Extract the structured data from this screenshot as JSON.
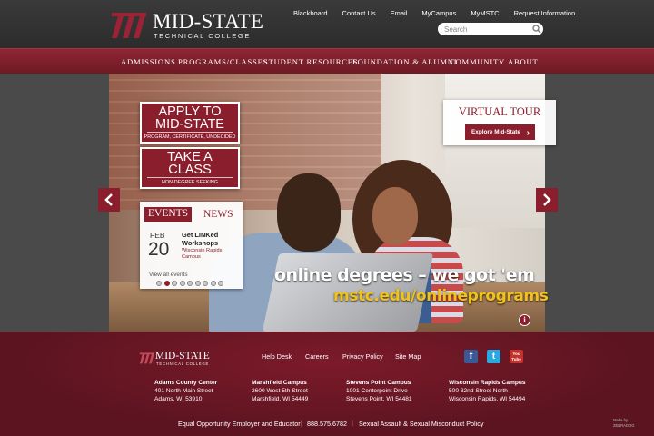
{
  "header": {
    "logo_name": "MID-STATE",
    "logo_sub": "TECHNICAL COLLEGE",
    "top_links": [
      "Blackboard",
      "Contact Us",
      "Email",
      "MyCampus",
      "MyMSTC",
      "Request Information"
    ],
    "search": {
      "placeholder": "Search",
      "icon": "magnifier-icon"
    }
  },
  "nav": {
    "items": [
      "ADMISSIONS",
      "PROGRAMS/CLASSES",
      "STUDENT RESOURCES",
      "FOUNDATION & ALUMNI",
      "COMMUNITY",
      "ABOUT"
    ]
  },
  "hero": {
    "apply": {
      "title_line1": "APPLY TO",
      "title_line2": "MID-STATE",
      "sub": "PROGRAM, CERTIFICATE, UNDECIDED"
    },
    "take_class": {
      "title_line1": "TAKE A",
      "title_line2": "CLASS",
      "sub": "NON-DEGREE SEEKING"
    },
    "events": {
      "tab_events": "EVENTS",
      "tab_news": "NEWS",
      "month": "FEB",
      "day": "20",
      "name": "Get LINKed Workshops",
      "location": "Wisconsin Rapids Campus",
      "view_all": "View all events"
    },
    "virtual_tour": {
      "title": "VIRTUAL TOUR",
      "button": "Explore Mid-State",
      "chevron": "›"
    },
    "tagline": "online degrees – we got 'em",
    "url": "mstc.edu/onlineprograms",
    "info": "i",
    "slide_count": 9,
    "active_slide": 2
  },
  "footer": {
    "logo_name": "MID-STATE",
    "logo_sub": "TECHNICAL COLLEGE",
    "links": [
      "Help Desk",
      "Careers",
      "Privacy Policy",
      "Site Map"
    ],
    "social": [
      {
        "icon": "facebook-icon",
        "glyph": "f",
        "color": "#3b5998"
      },
      {
        "icon": "twitter-icon",
        "glyph": "t",
        "color": "#2aa9e0"
      },
      {
        "icon": "youtube-icon",
        "glyph": "You Tube",
        "color": "#c4302b"
      }
    ],
    "campuses": [
      {
        "name": "Adams County Center",
        "street": "401 North Main Street",
        "city": "Adams, WI 53910"
      },
      {
        "name": "Marshfield Campus",
        "street": "2600 West 5th Street",
        "city": "Marshfield, WI 54449"
      },
      {
        "name": "Stevens Point Campus",
        "street": "1001 Centerpoint Drive",
        "city": "Stevens Point, WI 54481"
      },
      {
        "name": "Wisconsin Rapids Campus",
        "street": "500 32nd Street North",
        "city": "Wisconsin Rapids, WI 54494"
      }
    ],
    "equal_opportunity": "Equal Opportunity Employer and Educator",
    "phone": "888.575.6782",
    "policy": "Sexual Assault & Sexual Misconduct Policy",
    "made_by_1": "Made by",
    "made_by_2": "ZEBRADOG"
  },
  "colors": {
    "brand": "#8a1e2c",
    "accent_yellow": "#f2c21a",
    "header": "#333333"
  }
}
